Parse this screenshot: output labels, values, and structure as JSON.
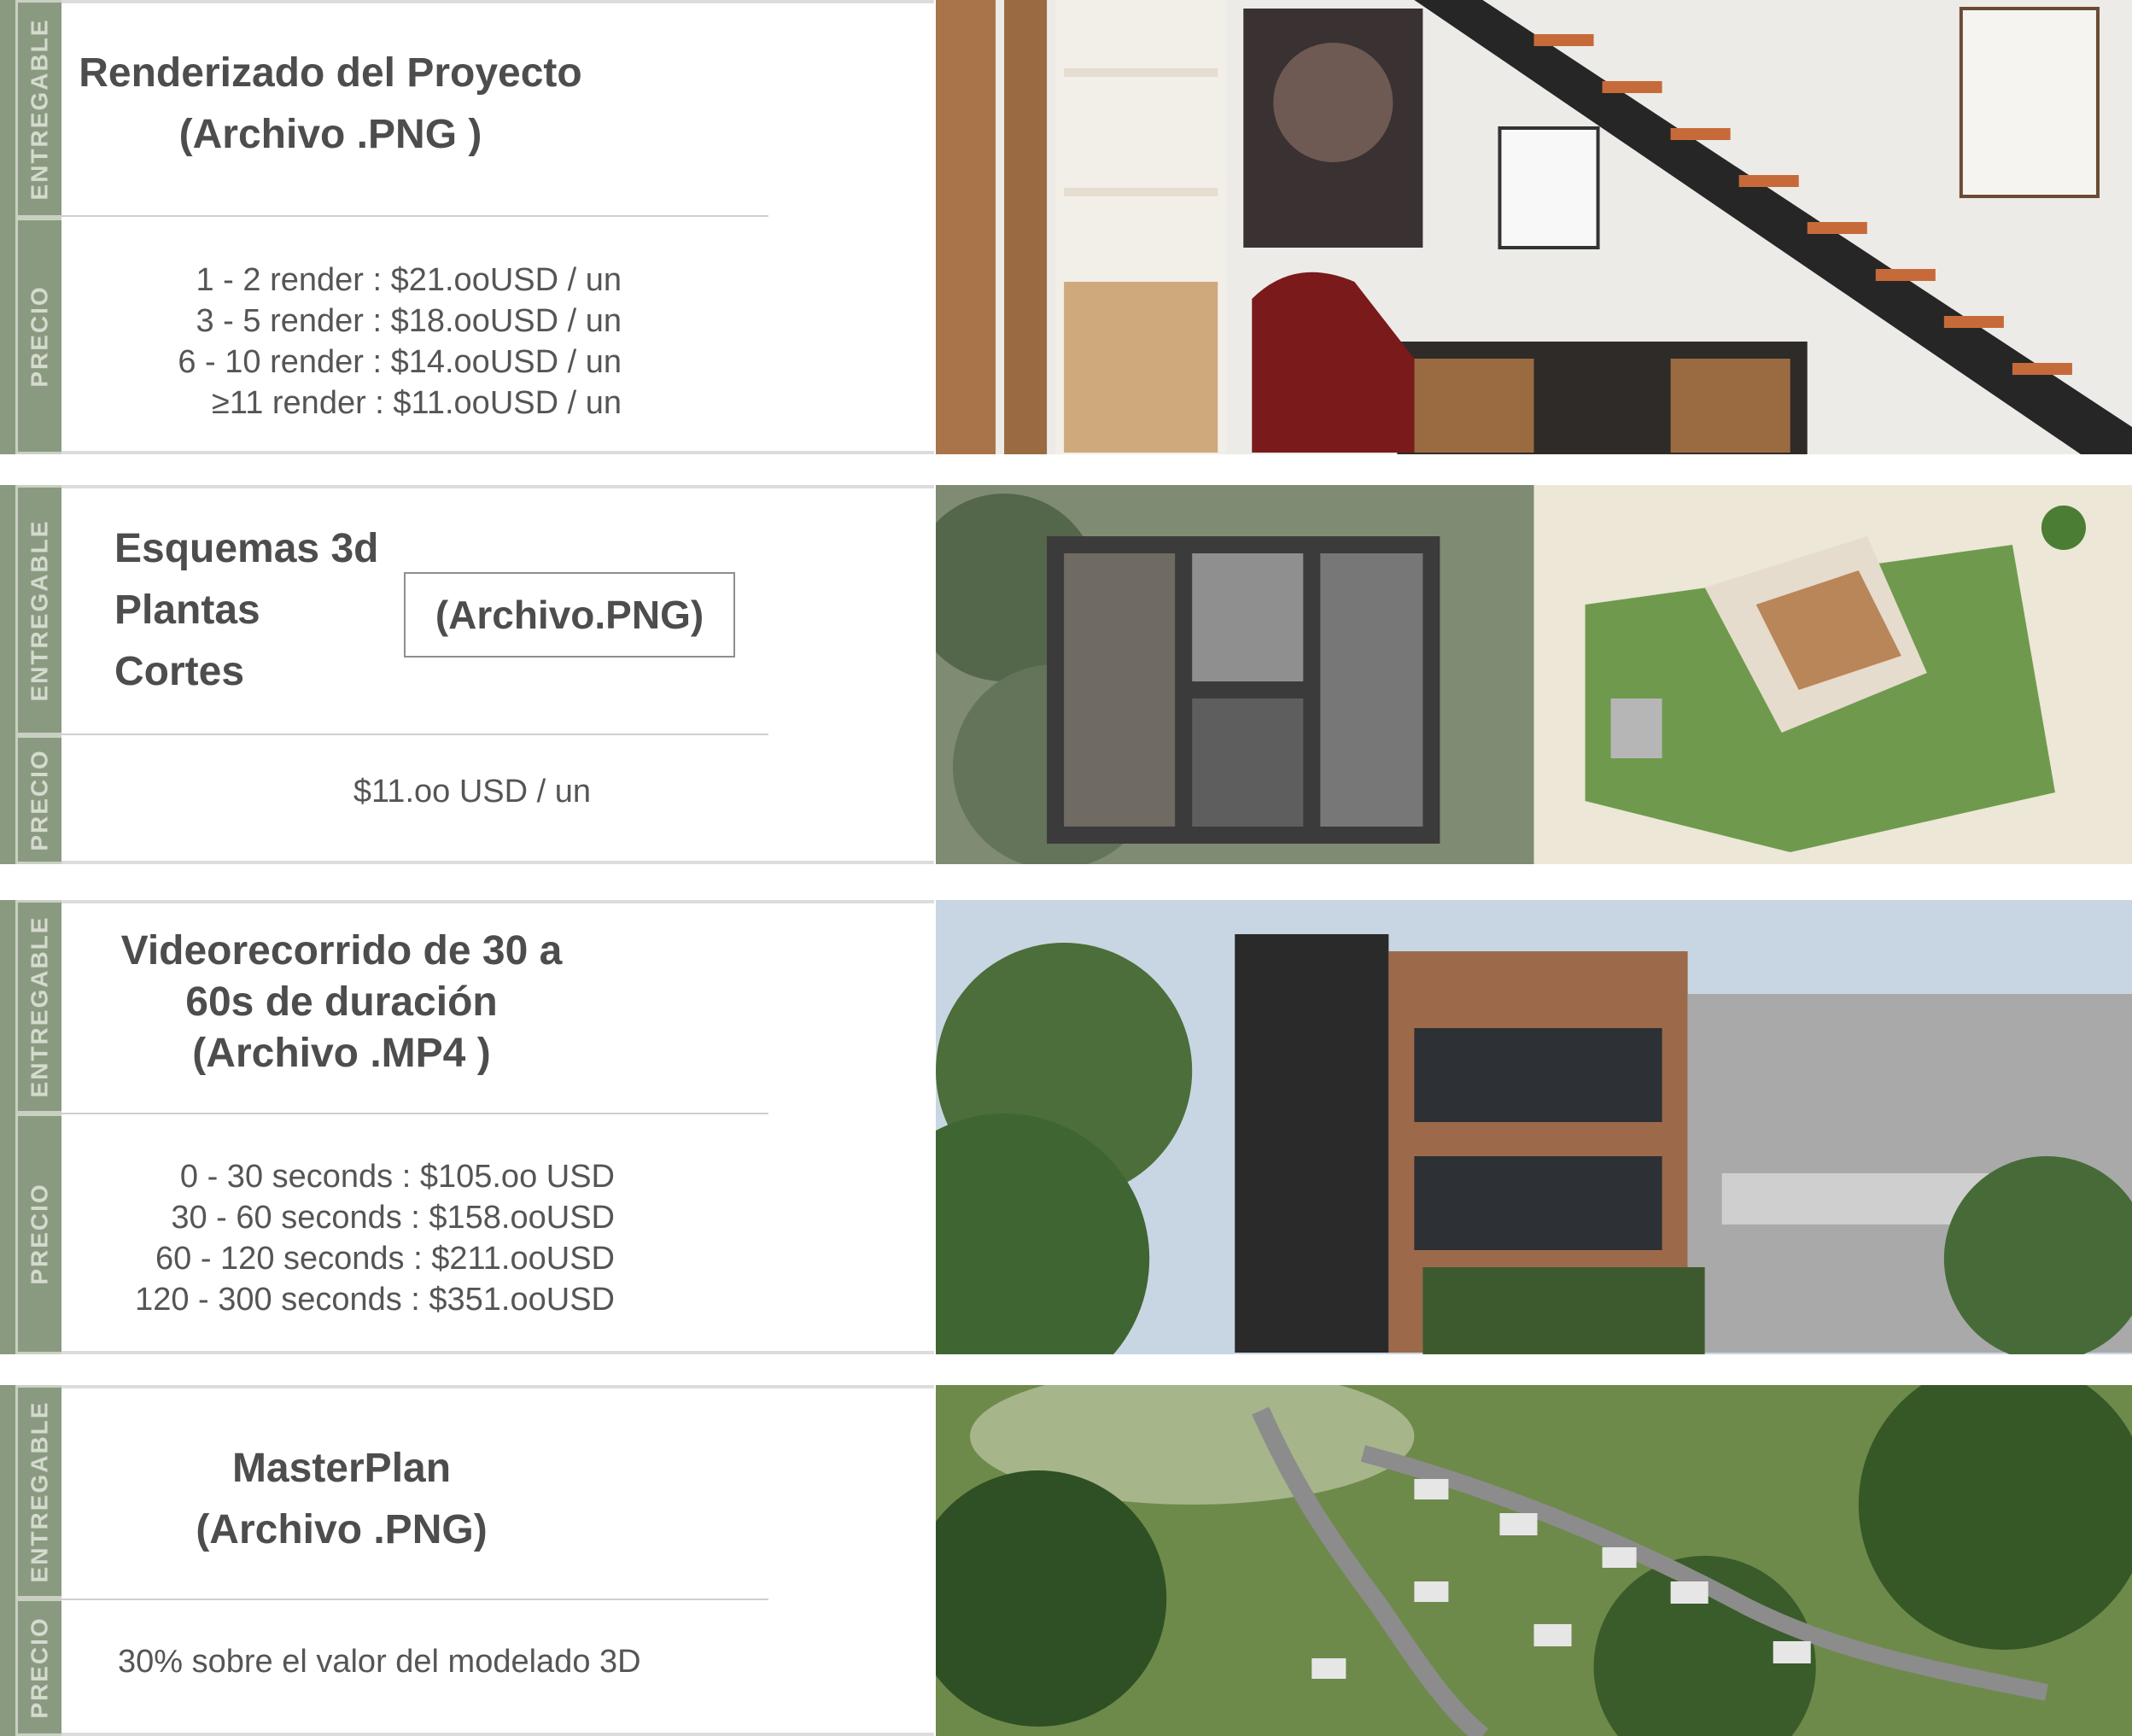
{
  "rail": {
    "deliverable": "ENTREGABLE",
    "price": "PRECIO"
  },
  "sections": [
    {
      "title_lines": [
        "Renderizado del Proyecto",
        "(Archivo .PNG )"
      ],
      "prices": [
        "1 - 2 render : $21.ooUSD / un",
        "3 - 5 render : $18.ooUSD / un",
        "6 - 10 render : $14.ooUSD / un",
        "≥11 render : $11.ooUSD / un"
      ]
    },
    {
      "title_lines": [
        "Esquemas 3d",
        "Plantas",
        "Cortes"
      ],
      "file_label": "(Archivo.PNG)",
      "prices": [
        "$11.oo USD / un"
      ]
    },
    {
      "title_lines": [
        "Videorecorrido de 30 a",
        "60s de duración",
        "(Archivo .MP4 )"
      ],
      "prices": [
        "0 - 30 seconds : $105.oo USD",
        "30 - 60 seconds : $158.ooUSD",
        "60 - 120 seconds : $211.ooUSD",
        "120 - 300 seconds : $351.ooUSD"
      ]
    },
    {
      "title_lines": [
        "MasterPlan",
        "(Archivo .PNG)"
      ],
      "prices": [
        "30% sobre el valor del modelado 3D"
      ]
    }
  ],
  "colors": {
    "rail": "#8a9a80",
    "rail_text": "#d4dacd",
    "text": "#4d4d4d"
  }
}
